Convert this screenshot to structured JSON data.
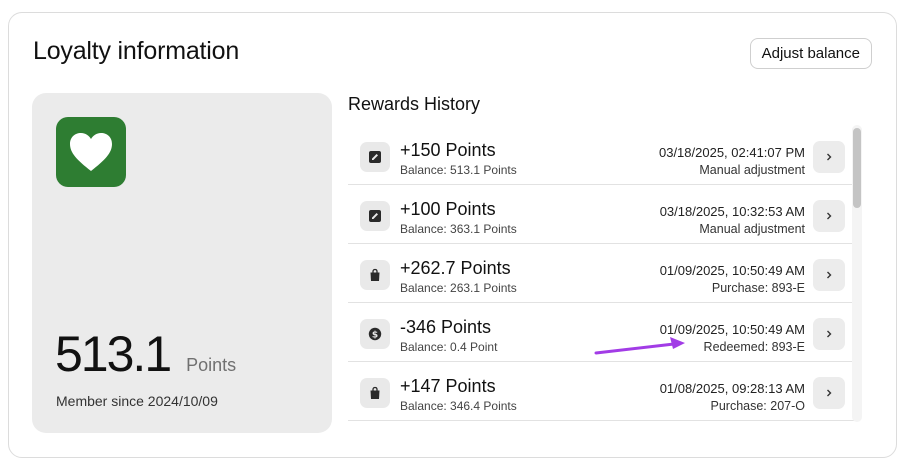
{
  "header": {
    "title": "Loyalty information",
    "adjust_label": "Adjust balance"
  },
  "member": {
    "logo_icon": "heart-icon",
    "logo_color": "#2e7d32",
    "balance": "513.1",
    "balance_unit": "Points",
    "member_since": "Member since 2024/10/09"
  },
  "history": {
    "title": "Rewards History",
    "rows": [
      {
        "icon": "edit-icon",
        "points": "+150 Points",
        "balance": "Balance: 513.1 Points",
        "date": "03/18/2025, 02:41:07 PM",
        "note": "Manual adjustment"
      },
      {
        "icon": "edit-icon",
        "points": "+100 Points",
        "balance": "Balance: 363.1 Points",
        "date": "03/18/2025, 10:32:53 AM",
        "note": "Manual adjustment"
      },
      {
        "icon": "shopping-bag-icon",
        "points": "+262.7 Points",
        "balance": "Balance: 263.1 Points",
        "date": "01/09/2025, 10:50:49 AM",
        "note": "Purchase: 893-E"
      },
      {
        "icon": "dollar-coin-icon",
        "points": "-346 Points",
        "balance": "Balance: 0.4 Point",
        "date": "01/09/2025, 10:50:49 AM",
        "note": "Redeemed: 893-E"
      },
      {
        "icon": "shopping-bag-icon",
        "points": "+147 Points",
        "balance": "Balance: 346.4 Points",
        "date": "01/08/2025, 09:28:13 AM",
        "note": "Purchase: 207-O"
      }
    ]
  },
  "annotation": {
    "arrow_color": "#a23ce6"
  }
}
